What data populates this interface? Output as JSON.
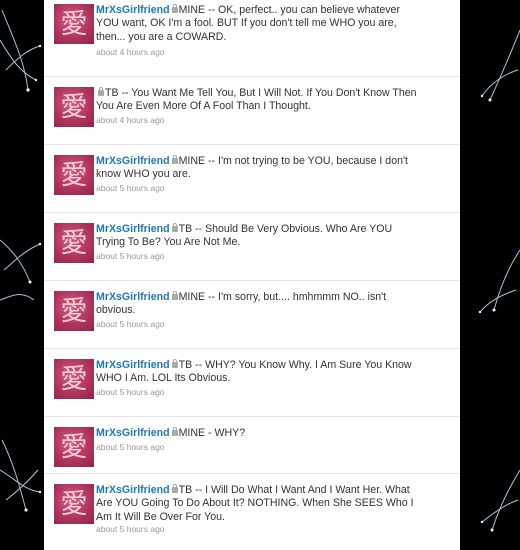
{
  "colors": {
    "page_background": "#000000",
    "timeline_background": "#ffffff",
    "username": "#2276bb",
    "tweet_text": "#333333",
    "timestamp": "#999999",
    "avatar": "#b03460",
    "sparkle": "#bfe9ff"
  },
  "icons": {
    "protected": "lock-icon",
    "avatar_glyph": "愛"
  },
  "tweets": [
    {
      "username": "MrXsGirlfriend",
      "text": "MINE -- OK, perfect.. you can believe whatever YOU want, OK I'm a fool. BUT If you don't tell me WHO you are, then... you are a COWARD.",
      "time": "about 4 hours ago"
    },
    {
      "username": "",
      "text": "TB -- You Want Me Tell You, But I Will Not. If You Don't Know Then You Are Even More Of A Fool Than I Thought.",
      "time": "about 4 hours ago"
    },
    {
      "username": "MrXsGirlfriend",
      "text": "MINE -- I'm not trying to be YOU, because I don't know WHO you are.",
      "time": "about 5 hours ago"
    },
    {
      "username": "MrXsGirlfriend",
      "text": "TB -- Should Be Very Obvious. Who Are YOU Trying To Be? You Are Not Me.",
      "time": "about 5 hours ago"
    },
    {
      "username": "MrXsGirlfriend",
      "text": "MINE -- I'm sorry, but.... hmhmmm NO.. isn't obvious.",
      "time": "about 5 hours ago"
    },
    {
      "username": "MrXsGirlfriend",
      "text": "TB -- WHY? You Know Why. I Am Sure You Know WHO I Am. LOL Its Obvious.",
      "time": "about 5 hours ago"
    },
    {
      "username": "MrXsGirlfriend",
      "text": "MINE - WHY?",
      "time": "about 5 hours ago"
    },
    {
      "username": "MrXsGirlfriend",
      "text": "TB -- I Will Do What I Want And I Want Her. What Are YOU Going To Do About It? NOTHING. When She SEES Who I Am It Will Be Over For You.",
      "time": "about 5 hours ago"
    }
  ]
}
